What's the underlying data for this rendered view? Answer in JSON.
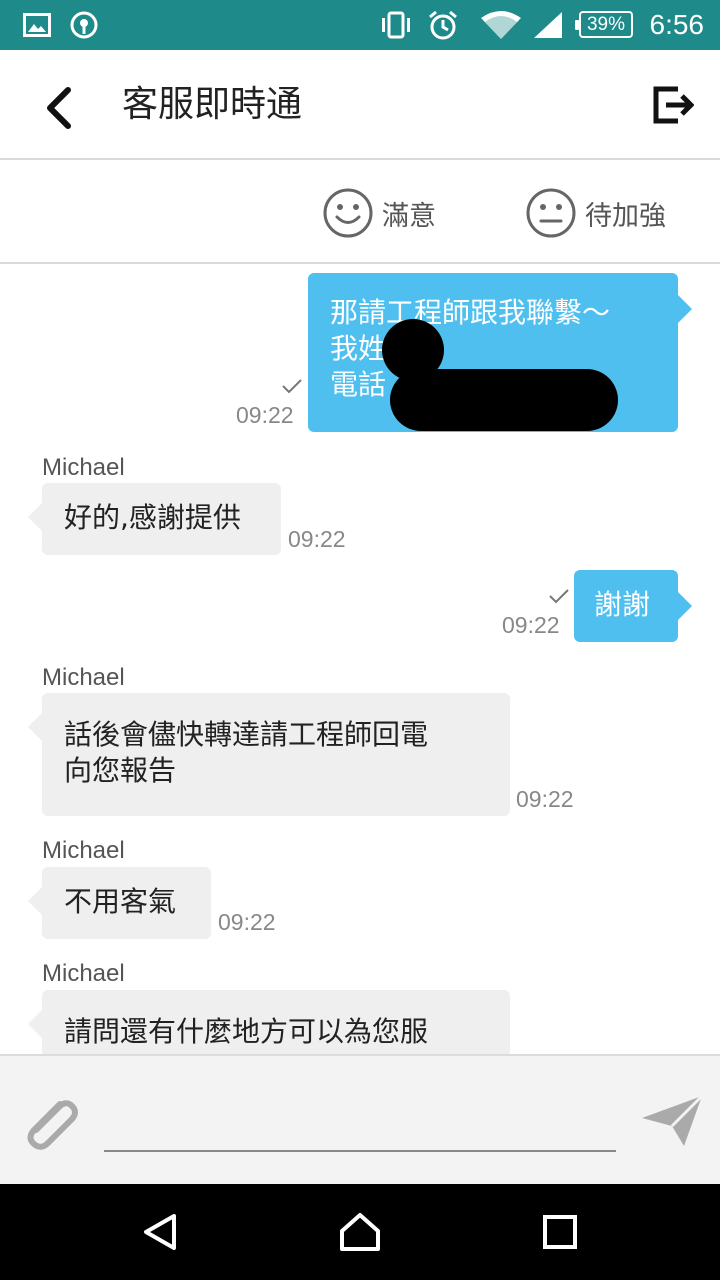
{
  "status_bar": {
    "battery": "39%",
    "time": "6:56"
  },
  "app_bar": {
    "title": "客服即時通"
  },
  "rating": {
    "satisfied_label": "滿意",
    "improve_label": "待加強"
  },
  "messages": [
    {
      "direction": "out",
      "lines": [
        "那請工程師跟我聯繫～",
        "我姓",
        "電話"
      ],
      "time": "09:22"
    },
    {
      "direction": "in",
      "sender": "Michael",
      "text": "好的,感謝提供",
      "time": "09:22"
    },
    {
      "direction": "out",
      "text": "謝謝",
      "time": "09:22"
    },
    {
      "direction": "in",
      "sender": "Michael",
      "lines": [
        "話後會儘快轉達請工程師回電",
        "向您報告"
      ],
      "time": "09:22"
    },
    {
      "direction": "in",
      "sender": "Michael",
      "text": "不用客氣",
      "time": "09:22"
    },
    {
      "direction": "in",
      "sender": "Michael",
      "text": "請問還有什麼地方可以為您服"
    }
  ],
  "input": {
    "value": "",
    "placeholder": ""
  },
  "icons": {
    "back": "chevron-left-icon",
    "exit": "exit-icon",
    "satisfied": "smile-face-icon",
    "improve": "neutral-face-icon",
    "attach": "paperclip-icon",
    "send": "send-icon",
    "nav_back": "triangle-back-icon",
    "nav_home": "home-icon",
    "nav_recents": "square-recents-icon"
  },
  "colors": {
    "status_bar": "#1f8a8a",
    "bubble_out": "#4fbff0",
    "bubble_in": "#efefef"
  }
}
